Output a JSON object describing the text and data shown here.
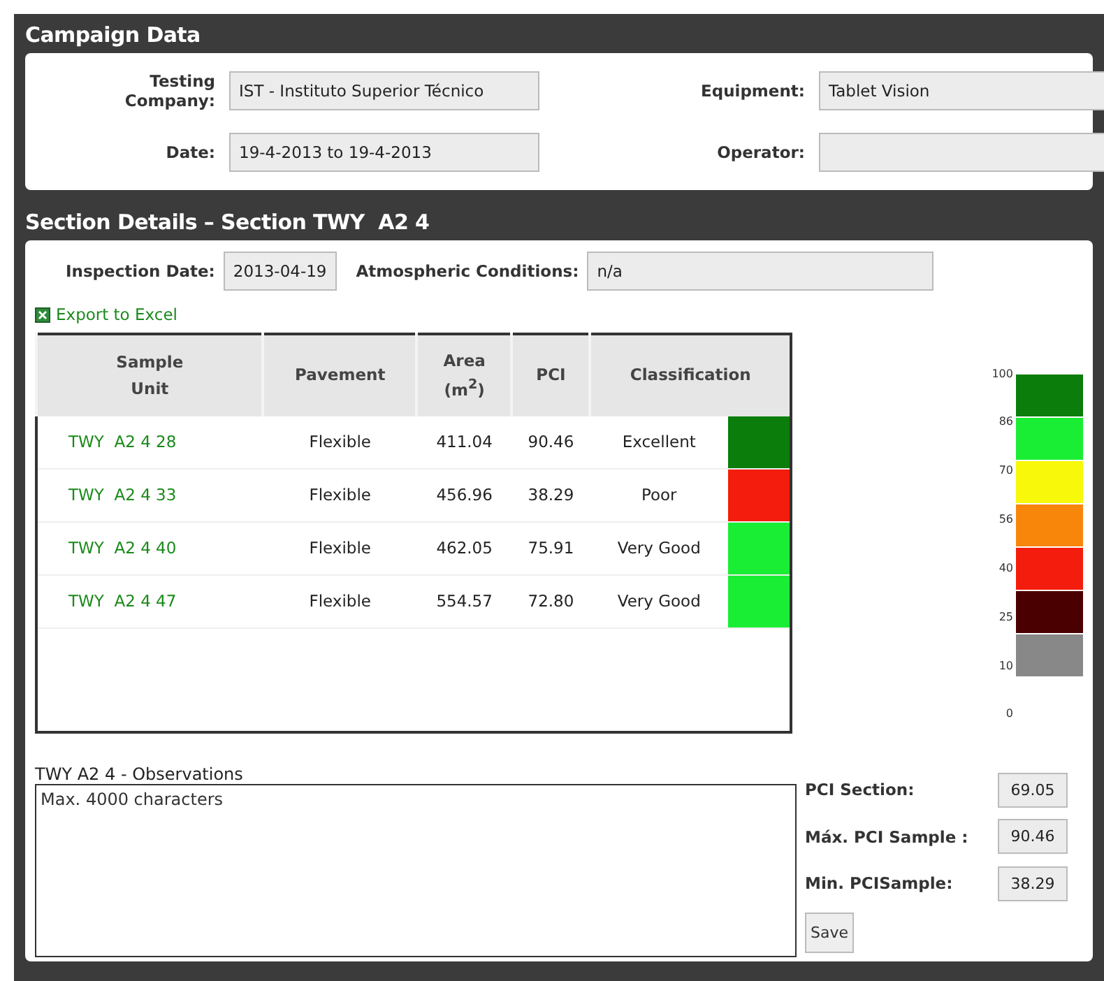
{
  "campaign": {
    "title": "Campaign Data",
    "fields": [
      {
        "label": "Testing Company:",
        "value": "IST - Instituto Superior Técnico"
      },
      {
        "label": "Equipment:",
        "value": "Tablet Vision"
      },
      {
        "label": "Date:",
        "value": "19-4-2013 to 19-4-2013"
      },
      {
        "label": "Operator:"
      }
    ]
  },
  "section": {
    "title": "Section Details – Section TWY  A2 4",
    "inspection_date": {
      "label": "Inspection Date:",
      "value": "2013-04-19"
    },
    "atmospheric": {
      "label": "Atmospheric Conditions:",
      "value": "n/a"
    },
    "export_link": "Export to Excel",
    "table": {
      "columns": [
        "Sample Unit",
        "Pavement",
        "Area (m$^{2}$)",
        "PCI",
        "Classification"
      ],
      "rows": [
        {
          "unit": "TWY  A2 4 28",
          "pavement": "Flexible",
          "area": "411.04",
          "pci": "90.46",
          "classification": "Excellent",
          "color": "#0a7d0a"
        },
        {
          "unit": "TWY  A2 4 33",
          "pavement": "Flexible",
          "area": "456.96",
          "pci": "38.29",
          "classification": "Poor",
          "color": "#f41c0c"
        },
        {
          "unit": "TWY  A2 4 40",
          "pavement": "Flexible",
          "area": "462.05",
          "pci": "75.91",
          "classification": "Very Good",
          "color": "#1aee34"
        },
        {
          "unit": "TWY  A2 4 47",
          "pavement": "Flexible",
          "area": "554.57",
          "pci": "72.80",
          "classification": "Very Good",
          "color": "#1aee34"
        }
      ]
    },
    "legend": {
      "ticks": [
        "100",
        "86",
        "70",
        "56",
        "40",
        "25",
        "10",
        "0"
      ],
      "bands": [
        {
          "color": "#0a7d0a"
        },
        {
          "color": "#1aee34"
        },
        {
          "color": "#f8f80a"
        },
        {
          "color": "#f8860a"
        },
        {
          "color": "#f41c0c"
        },
        {
          "color": "#4a0000"
        },
        {
          "color": "#888888"
        }
      ]
    },
    "observations": {
      "label": "TWY  A2 4 - Observations",
      "placeholder": "Max. 4000 characters"
    },
    "stats": [
      {
        "label": "PCI Section:",
        "value": "69.05"
      },
      {
        "label": "Máx. PCI Sample :",
        "value": "90.46"
      },
      {
        "label": "Min. PCISample:",
        "value": "38.29"
      }
    ],
    "save_button": "Save"
  }
}
